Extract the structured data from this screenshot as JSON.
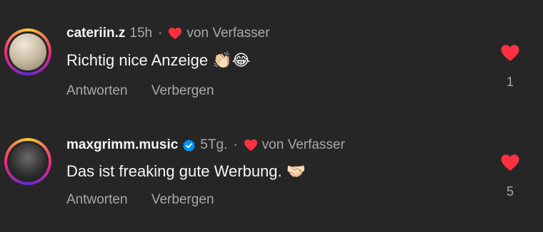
{
  "comments": [
    {
      "username": "cateriin.z",
      "time": "15h",
      "separator": "·",
      "author_label": "von Verfasser",
      "text": "Richtig nice Anzeige",
      "emoji": "👏🏻😂",
      "reply_label": "Antworten",
      "hide_label": "Verbergen",
      "like_count": "1",
      "verified": false
    },
    {
      "username": "maxgrimm.music",
      "time": "5Tg.",
      "separator": "·",
      "author_label": "von Verfasser",
      "text": "Das ist freaking gute Werbung.",
      "emoji": "🤝🏻",
      "reply_label": "Antworten",
      "hide_label": "Verbergen",
      "like_count": "5",
      "verified": true
    }
  ],
  "colors": {
    "background": "#262626",
    "like_red": "#ff3040",
    "verified_blue": "#0095f6",
    "secondary_text": "#a8a8a8"
  }
}
